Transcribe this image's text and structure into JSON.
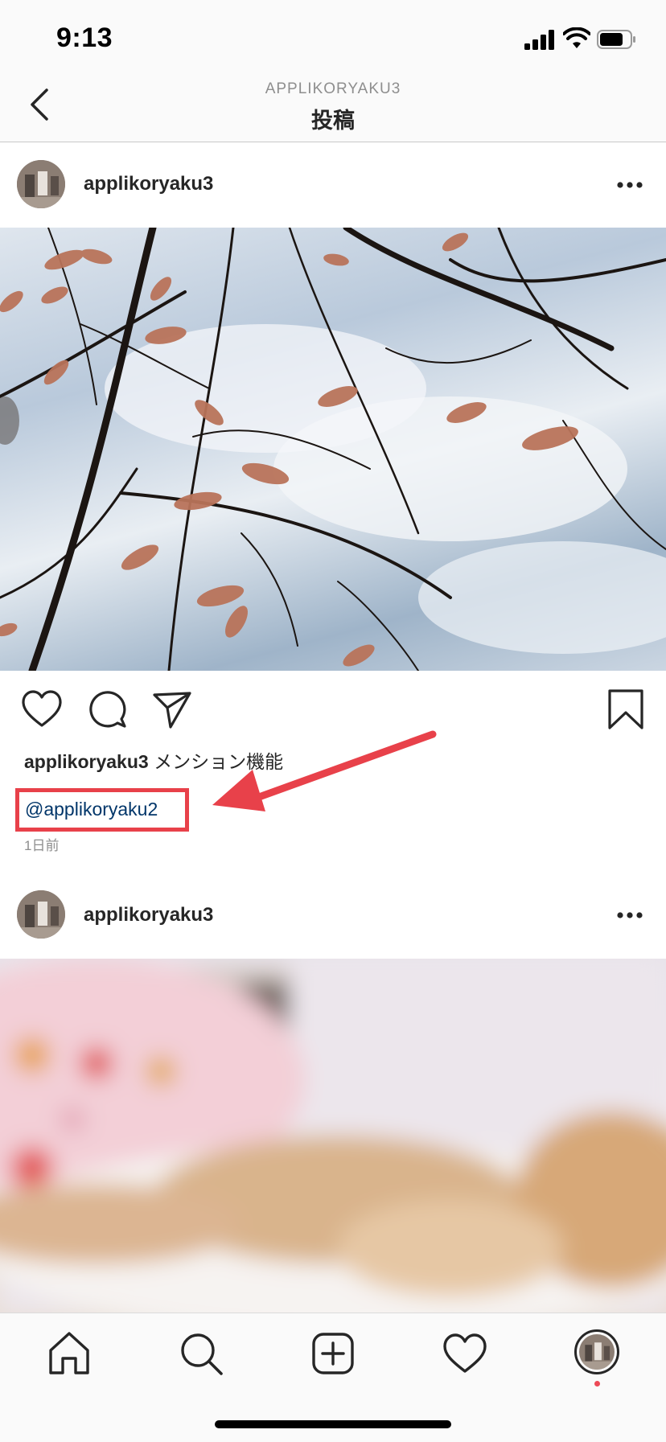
{
  "status": {
    "time": "9:13"
  },
  "nav": {
    "subtitle": "APPLIKORYAKU3",
    "title": "投稿"
  },
  "posts": [
    {
      "username": "applikoryaku3",
      "caption_user": "applikoryaku3",
      "caption_text": "メンション機能",
      "mention": "@applikoryaku2",
      "time_ago": "1日前"
    },
    {
      "username": "applikoryaku3"
    }
  ],
  "colors": {
    "annotation": "#e8414a",
    "link": "#003569",
    "notification_dot": "#ed4956"
  }
}
